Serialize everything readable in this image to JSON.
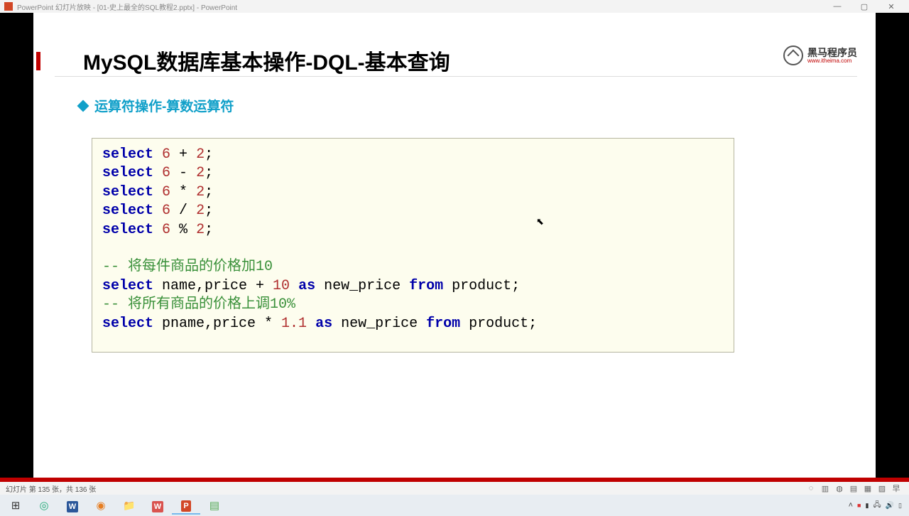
{
  "titlebar": {
    "title": "PowerPoint 幻灯片放映 - [01-史上最全的SQL教程2.pptx] - PowerPoint",
    "min": "—",
    "max": "▢",
    "close": "✕"
  },
  "slide": {
    "title": "MySQL数据库基本操作-DQL-基本查询",
    "subtitle": "运算符操作-算数运算符",
    "logo_text": "黑马程序员",
    "logo_sub": "www.itheima.com"
  },
  "code": {
    "l1_kw": "select",
    "l1_n1": "6",
    "l1_op": " + ",
    "l1_n2": "2",
    "l1_end": ";",
    "l2_kw": "select",
    "l2_n1": "6",
    "l2_op": " - ",
    "l2_n2": "2",
    "l2_end": ";",
    "l3_kw": "select",
    "l3_n1": "6",
    "l3_op": " * ",
    "l3_n2": "2",
    "l3_end": ";",
    "l4_kw": "select",
    "l4_n1": "6",
    "l4_op": " / ",
    "l4_n2": "2",
    "l4_end": ";",
    "l5_kw": "select",
    "l5_n1": "6",
    "l5_op": " % ",
    "l5_n2": "2",
    "l5_end": ";",
    "c1": "-- 将每件商品的价格加10",
    "l6_kw1": "select",
    "l6_t1": " name,price + ",
    "l6_n": "10",
    "l6_t2": " ",
    "l6_kw2": "as",
    "l6_t3": " new_price ",
    "l6_kw3": "from",
    "l6_t4": " product;",
    "c2": "-- 将所有商品的价格上调10%",
    "l7_kw1": "select",
    "l7_t1": " pname,price * ",
    "l7_n": "1.1",
    "l7_t2": " ",
    "l7_kw2": "as",
    "l7_t3": " new_price ",
    "l7_kw3": "from",
    "l7_t4": " product;"
  },
  "statusbar": {
    "text": "幻灯片 第 135 张，共 136 张"
  }
}
